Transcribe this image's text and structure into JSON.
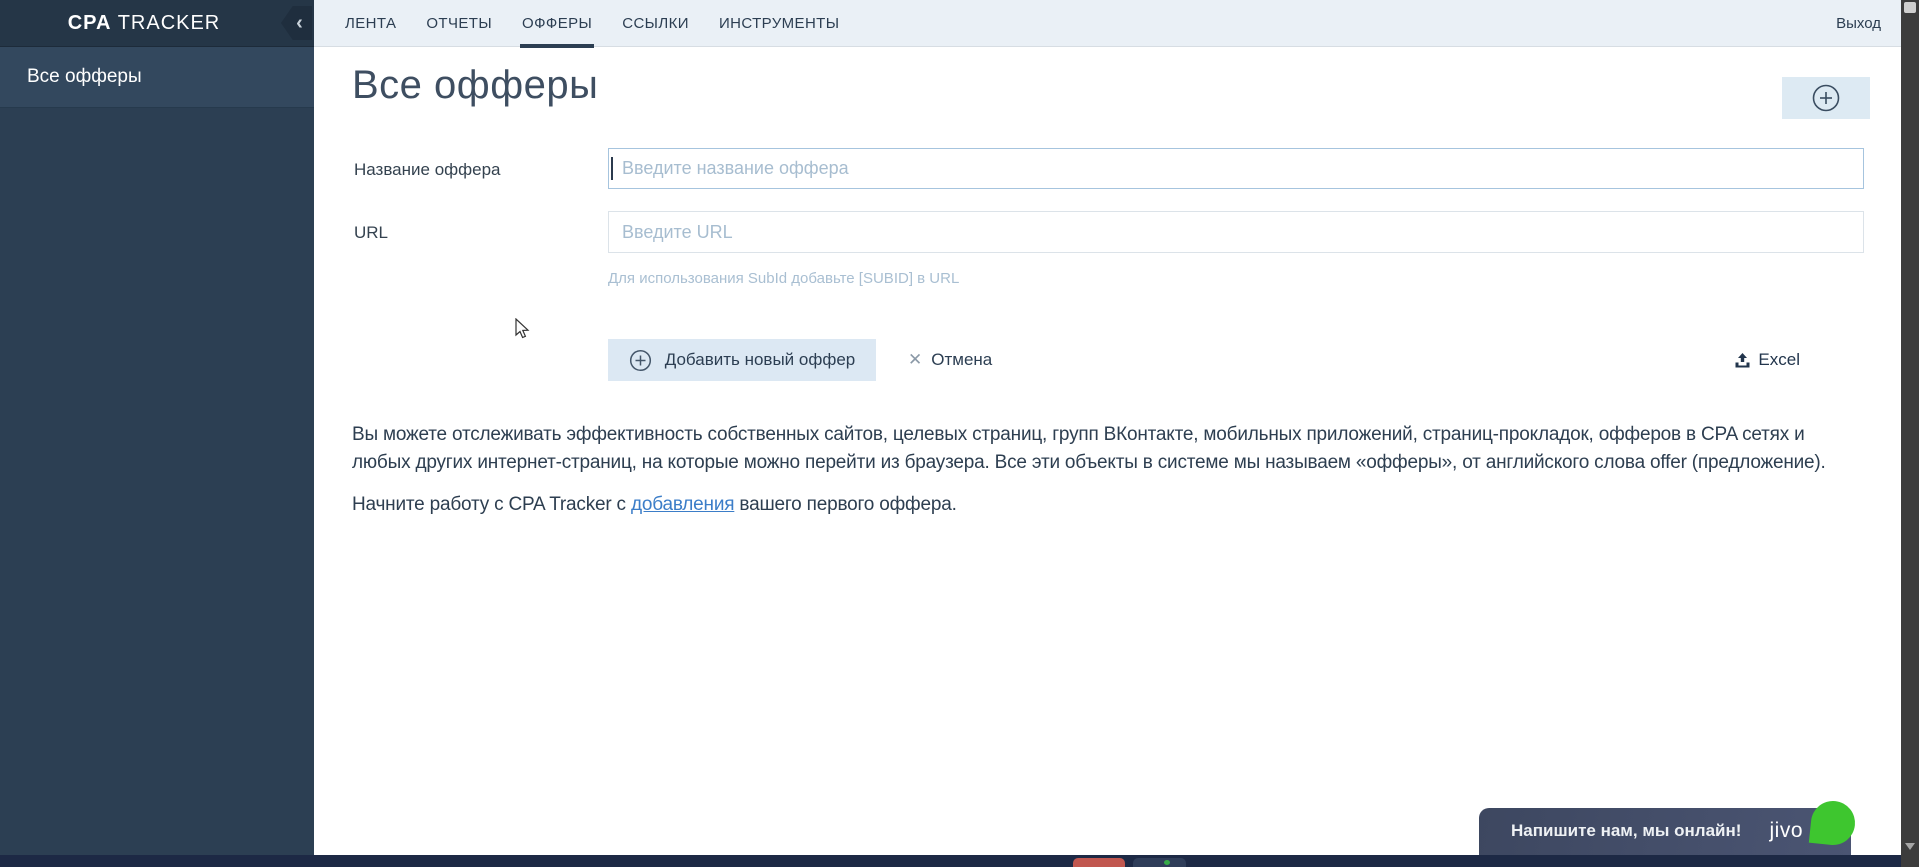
{
  "app": {
    "brand_bold": "CPA",
    "brand_rest": "TRACKER"
  },
  "topnav": {
    "tabs": [
      {
        "label": "ЛЕНТА",
        "active": false
      },
      {
        "label": "ОТЧЕТЫ",
        "active": false
      },
      {
        "label": "ОФФЕРЫ",
        "active": true
      },
      {
        "label": "ССЫЛКИ",
        "active": false
      },
      {
        "label": "ИНСТРУМЕНТЫ",
        "active": false
      }
    ],
    "logout": "Выход"
  },
  "sidebar": {
    "collapse_glyph": "‹",
    "items": [
      {
        "label": "Все офферы",
        "active": true
      }
    ]
  },
  "main": {
    "title": "Все офферы",
    "form": {
      "name_label": "Название оффера",
      "name_placeholder": "Введите название оффера",
      "name_value": "",
      "url_label": "URL",
      "url_placeholder": "Введите URL",
      "url_value": "",
      "url_hint": "Для использования SubId добавьте [SUBID] в URL",
      "submit_label": "Добавить новый оффер",
      "cancel_label": "Отмена",
      "cancel_glyph": "✕",
      "excel_label": "Excel"
    },
    "intro": {
      "paragraph": "Вы можете отслеживать эффективность собственных сайтов, целевых страниц, групп ВКонтакте, мобильных приложений, страниц-прокладок, офферов в CPA сетях и любых других интернет-страниц, на которые можно перейти из браузера. Все эти объекты в системе мы называем «офферы», от английского слова offer (предложение).",
      "start_prefix": "Начните работу с CPA Tracker с ",
      "start_link": "добавления",
      "start_suffix": " вашего первого оффера."
    }
  },
  "chat": {
    "message": "Напишите нам, мы онлайн!",
    "brand": "jivo"
  },
  "colors": {
    "sidebar_bg": "#2c3f53",
    "sidebar_top_bg": "#253647",
    "sidebar_active_bg": "#33485e",
    "topbar_bg": "#eaf0f6",
    "navy_text": "#2c3e52",
    "button_bg": "#dce8f3",
    "plus_button_bg": "#ddeaf3",
    "focused_input_border": "#a6c4de",
    "input_border": "#dce3e9",
    "placeholder": "#a7bdd0",
    "hint": "#a9bfd2",
    "link_blue": "#3b7dc8",
    "jivo_green": "#3ec62f",
    "chat_bg": "#424c66",
    "bar_bg": "#1d2945",
    "bar_red": "#c1574f"
  }
}
